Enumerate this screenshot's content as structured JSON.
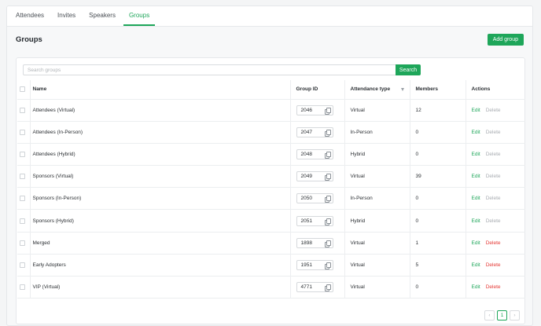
{
  "tabs": [
    {
      "label": "Attendees",
      "active": false
    },
    {
      "label": "Invites",
      "active": false
    },
    {
      "label": "Speakers",
      "active": false
    },
    {
      "label": "Groups",
      "active": true
    }
  ],
  "header": {
    "title": "Groups",
    "add_label": "Add group"
  },
  "search": {
    "placeholder": "Search groups",
    "value": "",
    "button_label": "Search"
  },
  "table": {
    "columns": [
      "Name",
      "Group ID",
      "Attendance type",
      "Members",
      "Actions"
    ],
    "edit_label": "Edit",
    "delete_label": "Delete",
    "rows": [
      {
        "name": "Attendees (Virtual)",
        "group_id": "2046",
        "attendance": "Virtual",
        "members": "12",
        "delete_enabled": false
      },
      {
        "name": "Attendees (In-Person)",
        "group_id": "2047",
        "attendance": "In-Person",
        "members": "0",
        "delete_enabled": false
      },
      {
        "name": "Attendees (Hybrid)",
        "group_id": "2048",
        "attendance": "Hybrid",
        "members": "0",
        "delete_enabled": false
      },
      {
        "name": "Sponsors (Virtual)",
        "group_id": "2049",
        "attendance": "Virtual",
        "members": "39",
        "delete_enabled": false
      },
      {
        "name": "Sponsors (In-Person)",
        "group_id": "2050",
        "attendance": "In-Person",
        "members": "0",
        "delete_enabled": false
      },
      {
        "name": "Sponsors (Hybrid)",
        "group_id": "2051",
        "attendance": "Hybrid",
        "members": "0",
        "delete_enabled": false
      },
      {
        "name": "Merged",
        "group_id": "1898",
        "attendance": "Virtual",
        "members": "1",
        "delete_enabled": true
      },
      {
        "name": "Early Adopters",
        "group_id": "1951",
        "attendance": "Virtual",
        "members": "5",
        "delete_enabled": true
      },
      {
        "name": "VIP (Virtual)",
        "group_id": "4771",
        "attendance": "Virtual",
        "members": "0",
        "delete_enabled": true
      }
    ]
  },
  "pagination": {
    "prev": "‹",
    "current": "1",
    "next": "›"
  },
  "colors": {
    "accent": "#1ea65a",
    "danger": "#e53935",
    "disabled": "#a9adb2"
  },
  "icons": {
    "copy": "copy-icon",
    "filter": "filter-icon",
    "checkbox": "checkbox"
  }
}
